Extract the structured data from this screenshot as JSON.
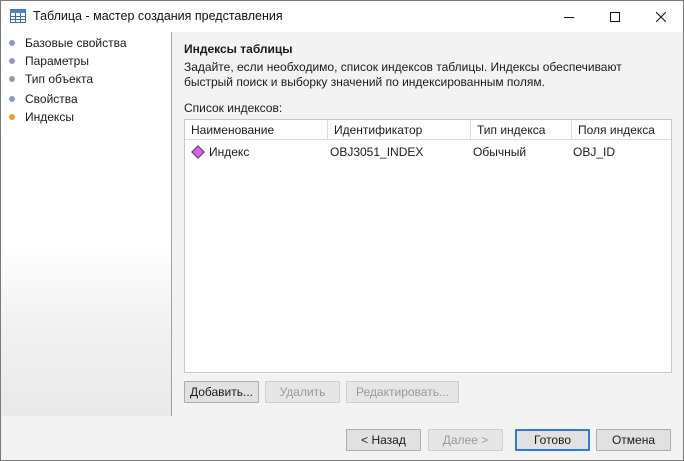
{
  "window": {
    "title": "Таблица - мастер создания представления",
    "controls": {
      "minimize": "minimize-icon",
      "maximize": "maximize-icon",
      "close": "close-icon"
    }
  },
  "nav": {
    "items": [
      {
        "label": "Базовые свойства",
        "active": false
      },
      {
        "label": "Параметры",
        "active": false
      },
      {
        "label": "Тип объекта",
        "active": false
      },
      {
        "label": "Свойства",
        "active": false
      },
      {
        "label": "Индексы",
        "active": true
      }
    ],
    "colors": {
      "inactive_dot": "#8aa0b8",
      "active_dot": "#f0a030"
    }
  },
  "page": {
    "title": "Индексы таблицы",
    "description": "Задайте, если необходимо, список индексов таблицы. Индексы обеспечивают быстрый поиск и выборку значений по индексированным полям.",
    "list_label": "Список индексов:"
  },
  "table": {
    "columns": [
      "Наименование",
      "Идентификатор",
      "Тип индекса",
      "Поля индекса"
    ],
    "rows": [
      {
        "name": "Индекс",
        "identifier": "OBJ3051_INDEX",
        "type": "Обычный",
        "fields": "OBJ_ID",
        "icon": "index-diamond-icon"
      }
    ]
  },
  "table_buttons": {
    "add": "Добавить...",
    "delete": "Удалить",
    "edit": "Редактировать..."
  },
  "footer_buttons": {
    "back": "< Назад",
    "next": "Далее >",
    "finish": "Готово",
    "cancel": "Отмена"
  },
  "colors": {
    "accent": "#2f7bd7",
    "diamond_fill": "#c86ad8",
    "diamond_stroke": "#6a2a8a"
  }
}
